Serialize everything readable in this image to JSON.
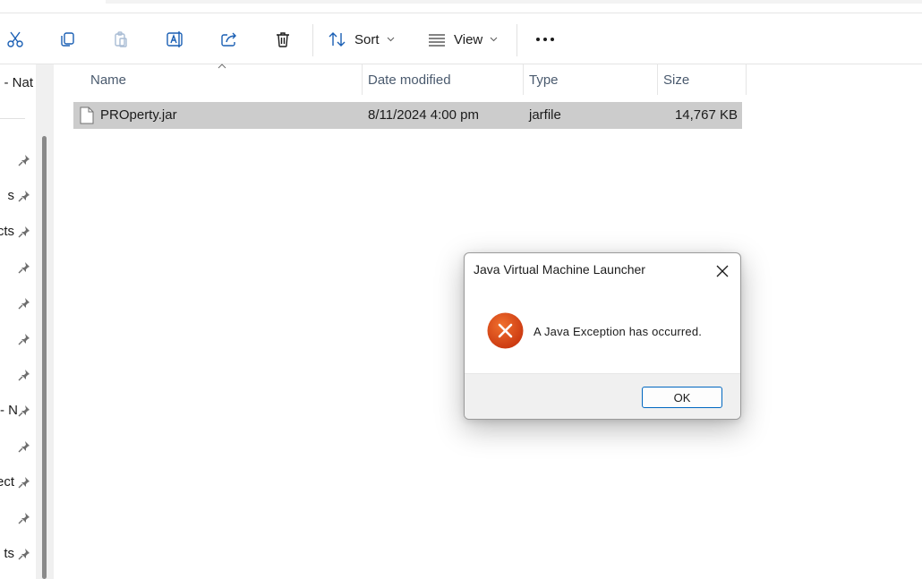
{
  "toolbar": {
    "cut": "cut-icon",
    "copy": "copy-icon",
    "paste": "paste-icon",
    "rename": "rename-icon",
    "share": "share-icon",
    "delete": "delete-icon",
    "sort_label": "Sort",
    "view_label": "View",
    "more": "more-icon"
  },
  "sidebar": {
    "top_label": "- Nat",
    "items": [
      {
        "label": ""
      },
      {
        "label": "s"
      },
      {
        "label": "cts"
      },
      {
        "label": ""
      },
      {
        "label": ""
      },
      {
        "label": ""
      },
      {
        "label": ""
      },
      {
        "label": "- N"
      },
      {
        "label": ""
      },
      {
        "label": "ect"
      },
      {
        "label": ""
      },
      {
        "label": "ts"
      }
    ]
  },
  "columns": {
    "name": "Name",
    "date": "Date modified",
    "type": "Type",
    "size": "Size"
  },
  "files": [
    {
      "name": "PROperty.jar",
      "date": "8/11/2024 4:00 pm",
      "type": "jarfile",
      "size": "14,767 KB"
    }
  ],
  "dialog": {
    "title": "Java Virtual Machine Launcher",
    "message": "A Java Exception has occurred.",
    "ok_label": "OK",
    "icon": "error-icon"
  },
  "colors": {
    "selection": "#cccccc",
    "error_red": "#d9441c",
    "accent": "#0067c0"
  }
}
